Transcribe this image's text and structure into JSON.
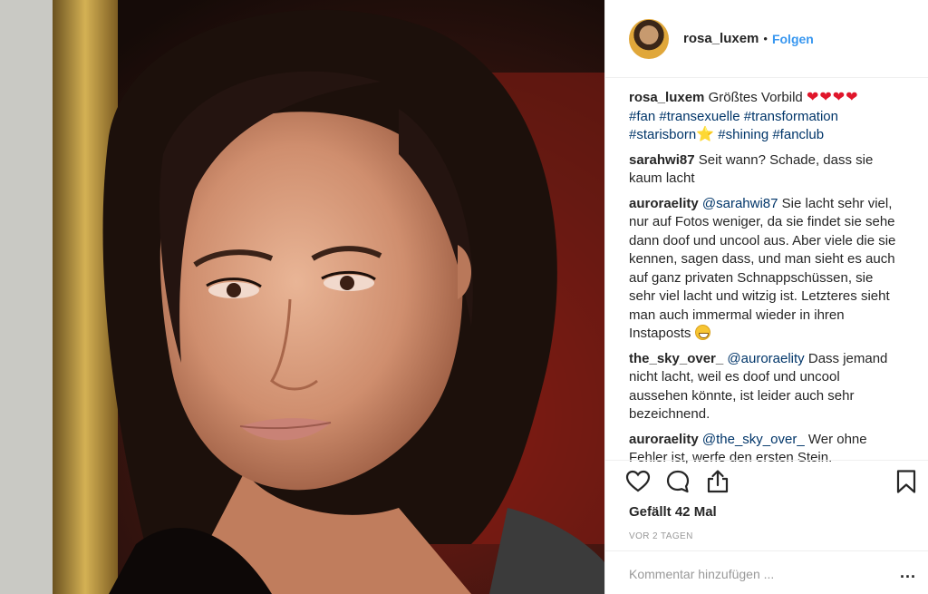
{
  "header": {
    "username": "rosa_luxem",
    "separator": "•",
    "follow_label": "Folgen"
  },
  "caption": {
    "username": "rosa_luxem",
    "text": "Größtes Vorbild",
    "hearts": "❤❤❤❤",
    "tags_line1": "#fan #transexuelle #transformation",
    "tag_starisborn": "#starisborn",
    "star": "⭐",
    "tags_line3": "#shining #fanclub"
  },
  "comments": [
    {
      "username": "sarahwi87",
      "mention": "",
      "text": "Seit wann? Schade, dass sie kaum lacht"
    },
    {
      "username": "auroraelity",
      "mention": "@sarahwi87",
      "text": "Sie lacht sehr viel, nur auf Fotos weniger, da sie findet sie sehe dann doof und uncool aus. Aber viele die sie kennen, sagen dass, und man sieht es auch auf ganz privaten Schnappschüssen, sie sehr viel lacht und witzig ist. Letzteres sieht man auch immermal wieder in ihren Instaposts"
    },
    {
      "username": "the_sky_over_",
      "mention": "@auroraelity",
      "text": "Dass jemand nicht lacht, weil es doof und uncool aussehen könnte, ist leider auch sehr bezeichnend."
    },
    {
      "username": "auroraelity",
      "mention": "@the_sky_over_",
      "text": "Wer ohne Fehler ist, werfe den ersten Stein."
    }
  ],
  "actions": {
    "likes_label": "Gefällt 42 Mal",
    "time_ago": "VOR 2 TAGEN"
  },
  "add_comment": {
    "placeholder": "Kommentar hinzufügen ...",
    "more_label": "..."
  },
  "icons": {
    "like": "heart-outline-icon",
    "comment": "speech-bubble-icon",
    "share": "share-upload-icon",
    "save": "bookmark-icon"
  },
  "colors": {
    "link_blue": "#3897f0",
    "hashtag": "#003569",
    "heart_red": "#e0162b",
    "muted": "#999999",
    "text": "#262626"
  }
}
